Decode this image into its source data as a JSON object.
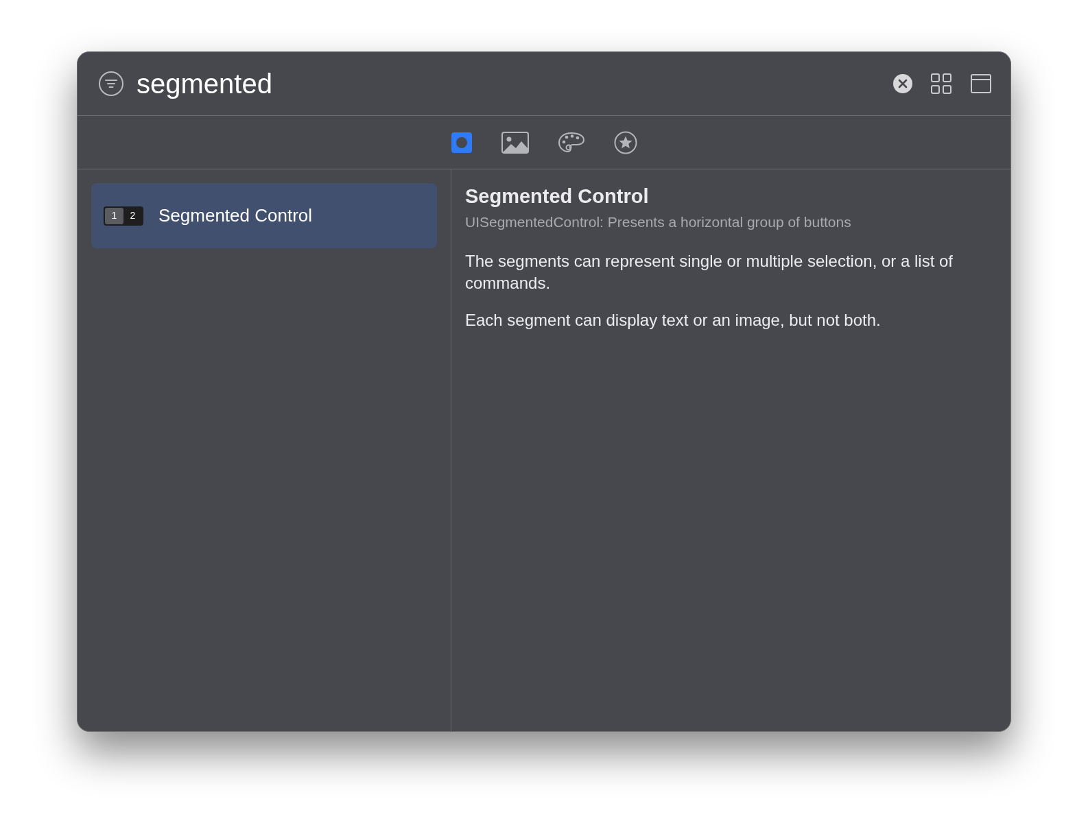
{
  "search": {
    "value": "segmented"
  },
  "tabs": [
    {
      "kind": "controls",
      "selected": true
    },
    {
      "kind": "media",
      "selected": false
    },
    {
      "kind": "colors",
      "selected": false
    },
    {
      "kind": "snippets",
      "selected": false
    }
  ],
  "results": [
    {
      "title": "Segmented Control",
      "segments": [
        "1",
        "2"
      ],
      "selected": true
    }
  ],
  "detail": {
    "title": "Segmented Control",
    "subtitle": "UISegmentedControl: Presents a horizontal group of buttons",
    "paragraphs": [
      "The segments can represent single or multiple selection, or a list of commands.",
      "Each segment can display text or an image, but not both."
    ]
  }
}
